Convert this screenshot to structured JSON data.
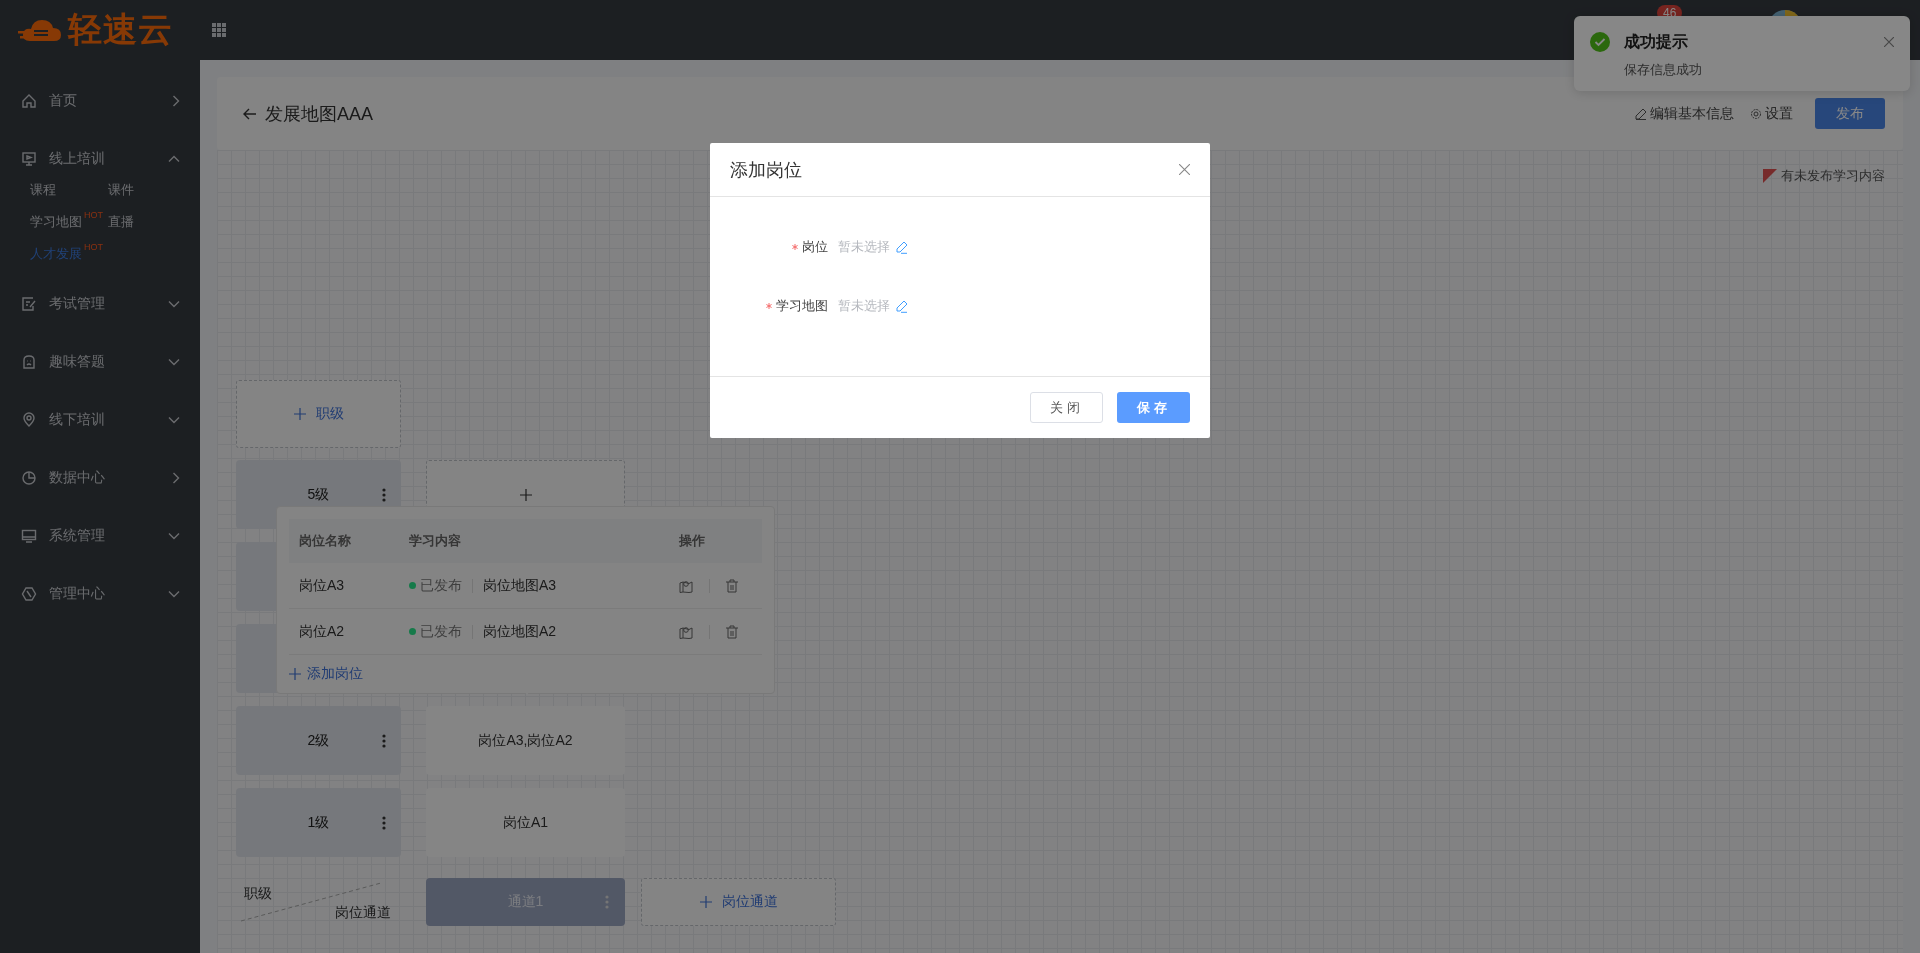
{
  "topbar": {
    "logo_text": "轻速云",
    "badge": "46"
  },
  "sidebar": {
    "items": [
      {
        "kind": "link",
        "label": "首页"
      },
      {
        "kind": "group",
        "label": "线上培训",
        "expanded": true,
        "children": [
          {
            "label": "课程",
            "selected": false
          },
          {
            "label": "课件",
            "selected": false
          },
          {
            "label": "学习地图",
            "badge": "HOT",
            "selected": false
          },
          {
            "label": "直播",
            "selected": false
          },
          {
            "label": "人才发展",
            "badge": "HOT",
            "selected": true
          }
        ]
      },
      {
        "kind": "group",
        "label": "考试管理",
        "expanded": false
      },
      {
        "kind": "group",
        "label": "趣味答题",
        "expanded": false
      },
      {
        "kind": "group",
        "label": "线下培训",
        "expanded": false
      },
      {
        "kind": "link",
        "label": "数据中心"
      },
      {
        "kind": "group",
        "label": "系统管理",
        "expanded": false
      },
      {
        "kind": "group",
        "label": "管理中心",
        "expanded": false
      }
    ]
  },
  "page_header": {
    "title": "发展地图AAA",
    "actions": [
      {
        "kind": "edit",
        "label": "编辑基本信息"
      },
      {
        "kind": "settings",
        "label": "设置"
      }
    ],
    "publish_button": "发布"
  },
  "notice": "有未发布学习内容",
  "board": {
    "add_level": "职级",
    "levels": [
      {
        "kind": "labeled",
        "label": "5级",
        "cell": {
          "kind": "add"
        }
      },
      {
        "kind": "covered"
      },
      {
        "kind": "covered"
      },
      {
        "kind": "labeled",
        "label": "2级",
        "cell": {
          "kind": "text",
          "text": "岗位A3,岗位A2"
        }
      },
      {
        "kind": "labeled",
        "label": "1级",
        "cell": {
          "kind": "text",
          "text": "岗位A1"
        }
      }
    ],
    "corner": {
      "row_header": "职级",
      "column_header": "岗位通道"
    },
    "channels": [
      {
        "label": "通道1"
      }
    ],
    "add_channel": "岗位通道"
  },
  "popover": {
    "columns": [
      "岗位名称",
      "学习内容",
      "操作"
    ],
    "rows": [
      {
        "name": "岗位A3",
        "status": "已发布",
        "color": "#177a4a",
        "map": "岗位地图A3"
      },
      {
        "name": "岗位A2",
        "status": "已发布",
        "color": "#177a4a",
        "map": "岗位地图A2"
      }
    ],
    "add_label": "添加岗位"
  },
  "modal": {
    "title": "添加岗位",
    "fields": [
      {
        "label": "岗位",
        "required": true,
        "placeholder": "暂未选择"
      },
      {
        "label": "学习地图",
        "required": true,
        "placeholder": "暂未选择"
      }
    ],
    "close_button": "关闭",
    "save_button": "保存"
  },
  "notification": {
    "title": "成功提示",
    "message": "保存信息成功"
  }
}
